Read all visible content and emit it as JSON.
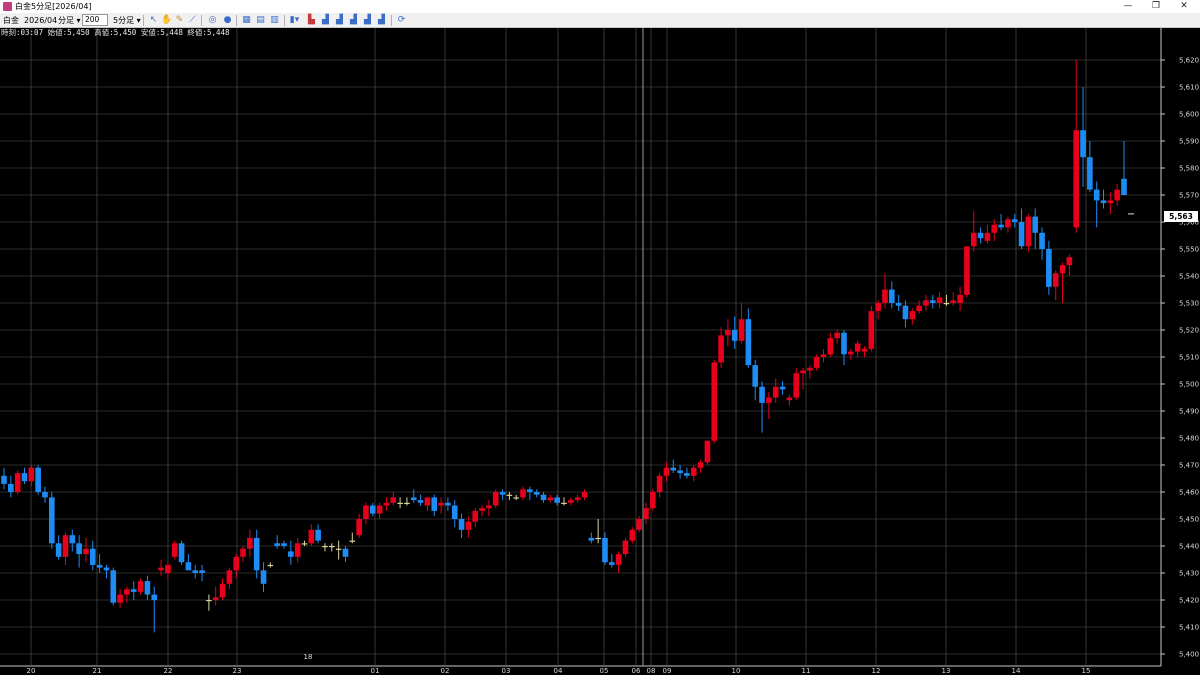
{
  "window": {
    "title": "白金5分足[2026/04]",
    "controls": [
      "—",
      "❐",
      "✕"
    ]
  },
  "toolbar": {
    "symbol": "白金",
    "contract": "2026/04",
    "unit_select": "分足 ▾",
    "count_value": "200",
    "interval_select": "5分足 ▾",
    "icons": [
      "cursor-icon",
      "hand-icon",
      "pencil-icon",
      "trend-line-icon",
      "circle-icon",
      "grid-icon",
      "table-icon",
      "list-icon",
      "bar-chart-icon",
      "bar-chart-red-icon",
      "bar-chart-2-icon",
      "bar-chart-3-icon",
      "bar-chart-4-icon",
      "bar-chart-5-icon",
      "refresh-icon"
    ]
  },
  "info": "時刻:03:07 始値:5,450 高値:5,450 安値:5,448 終値:5,448",
  "current_price": "5,563",
  "colors": {
    "up": "#e8001c",
    "down": "#1e8cf5",
    "doji": "#d8d49a",
    "grid": "#5a5a5a",
    "background": "#000000"
  },
  "chart_data": {
    "type": "candlestick",
    "y_axis": {
      "min": 5400,
      "max": 5620,
      "tick_step": 10,
      "tick_labels": [
        "5,400",
        "5,410",
        "5,420",
        "5,430",
        "5,440",
        "5,450",
        "5,460",
        "5,470",
        "5,480",
        "5,490",
        "5,500",
        "5,510",
        "5,520",
        "5,530",
        "5,540",
        "5,550",
        "5,560",
        "5,570",
        "5,580",
        "5,590",
        "5,600",
        "5,610",
        "5,620"
      ]
    },
    "x_labels": [
      "20",
      "21",
      "22",
      "23",
      "18",
      "01",
      "02",
      "03",
      "04",
      "05",
      "06",
      "08",
      "09",
      "10",
      "11",
      "12",
      "13",
      "14",
      "15"
    ],
    "ohlc": [
      [
        5466,
        5469,
        5461,
        5463
      ],
      [
        5463,
        5466,
        5458,
        5460
      ],
      [
        5460,
        5468,
        5459,
        5467
      ],
      [
        5467,
        5469,
        5463,
        5464
      ],
      [
        5464,
        5470,
        5462,
        5469
      ],
      [
        5469,
        5470,
        5459,
        5460
      ],
      [
        5460,
        5462,
        5456,
        5458
      ],
      [
        5458,
        5460,
        5439,
        5441
      ],
      [
        5441,
        5444,
        5435,
        5436
      ],
      [
        5436,
        5445,
        5433,
        5444
      ],
      [
        5444,
        5446,
        5438,
        5441
      ],
      [
        5441,
        5444,
        5432,
        5437
      ],
      [
        5437,
        5443,
        5434,
        5439
      ],
      [
        5439,
        5442,
        5431,
        5433
      ],
      [
        5433,
        5437,
        5430,
        5432
      ],
      [
        5432,
        5433,
        5428,
        5431
      ],
      [
        5431,
        5432,
        5418,
        5419
      ],
      [
        5419,
        5424,
        5417,
        5422
      ],
      [
        5422,
        5425,
        5419,
        5424
      ],
      [
        5424,
        5427,
        5420,
        5423
      ],
      [
        5423,
        5428,
        5422,
        5427
      ],
      [
        5427,
        5429,
        5420,
        5422
      ],
      [
        5422,
        5425,
        5408,
        5420
      ],
      [
        5431,
        5435,
        5429,
        5432
      ],
      [
        5430,
        5434,
        5428,
        5433
      ],
      [
        5436,
        5442,
        5435,
        5441
      ],
      [
        5441,
        5442,
        5433,
        5434
      ],
      [
        5434,
        5437,
        5431,
        5431
      ],
      [
        5431,
        5433,
        5428,
        5430
      ],
      [
        5431,
        5433,
        5427,
        5430
      ],
      [
        5420,
        5422,
        5416,
        5420
      ],
      [
        5420,
        5425,
        5418,
        5421
      ],
      [
        5421,
        5428,
        5420,
        5426
      ],
      [
        5426,
        5432,
        5424,
        5431
      ],
      [
        5431,
        5437,
        5428,
        5436
      ],
      [
        5436,
        5440,
        5434,
        5439
      ],
      [
        5439,
        5446,
        5436,
        5443
      ],
      [
        5443,
        5446,
        5428,
        5431
      ],
      [
        5431,
        5434,
        5423,
        5426
      ],
      [
        5433,
        5434,
        5432,
        5433
      ],
      [
        5441,
        5444,
        5439,
        5440
      ],
      [
        5441,
        5442,
        5439,
        5440
      ],
      [
        5438,
        5442,
        5433,
        5436
      ],
      [
        5436,
        5443,
        5434,
        5441
      ],
      [
        5441,
        5442,
        5440,
        5441
      ],
      [
        5441,
        5448,
        5440,
        5446
      ],
      [
        5446,
        5448,
        5441,
        5442
      ],
      [
        5440,
        5441,
        5438,
        5440
      ],
      [
        5440,
        5441,
        5438,
        5440
      ],
      [
        5439,
        5442,
        5435,
        5439
      ],
      [
        5439,
        5440,
        5434,
        5436
      ],
      [
        5442,
        5445,
        5441,
        5442
      ],
      [
        5444,
        5452,
        5443,
        5450
      ],
      [
        5450,
        5456,
        5448,
        5455
      ],
      [
        5455,
        5456,
        5451,
        5452
      ],
      [
        5452,
        5456,
        5450,
        5455
      ],
      [
        5455,
        5458,
        5453,
        5456
      ],
      [
        5456,
        5460,
        5455,
        5458
      ],
      [
        5456,
        5458,
        5454,
        5456
      ],
      [
        5456,
        5458,
        5455,
        5456
      ],
      [
        5458,
        5461,
        5456,
        5457
      ],
      [
        5457,
        5459,
        5455,
        5456
      ],
      [
        5455,
        5458,
        5453,
        5458
      ],
      [
        5458,
        5459,
        5451,
        5453
      ],
      [
        5455,
        5458,
        5452,
        5456
      ],
      [
        5456,
        5458,
        5453,
        5455
      ],
      [
        5455,
        5457,
        5447,
        5450
      ],
      [
        5450,
        5452,
        5443,
        5446
      ],
      [
        5446,
        5451,
        5443,
        5449
      ],
      [
        5449,
        5454,
        5447,
        5453
      ],
      [
        5453,
        5455,
        5451,
        5454
      ],
      [
        5454,
        5457,
        5451,
        5455
      ],
      [
        5455,
        5461,
        5454,
        5460
      ],
      [
        5460,
        5461,
        5457,
        5459
      ],
      [
        5459,
        5460,
        5457,
        5459
      ],
      [
        5458,
        5459,
        5457,
        5458
      ],
      [
        5458,
        5462,
        5457,
        5461
      ],
      [
        5461,
        5462,
        5457,
        5460
      ],
      [
        5460,
        5461,
        5458,
        5459
      ],
      [
        5459,
        5460,
        5456,
        5457
      ],
      [
        5457,
        5459,
        5456,
        5458
      ],
      [
        5458,
        5459,
        5455,
        5456
      ],
      [
        5456,
        5458,
        5455,
        5456
      ],
      [
        5456,
        5458,
        5455,
        5457
      ],
      [
        5457,
        5459,
        5456,
        5458
      ],
      [
        5458,
        5461,
        5457,
        5460
      ],
      [
        5443,
        5445,
        5441,
        5442
      ],
      [
        5443,
        5450,
        5441,
        5443
      ],
      [
        5443,
        5445,
        5433,
        5434
      ],
      [
        5434,
        5437,
        5432,
        5433
      ],
      [
        5433,
        5438,
        5430,
        5437
      ],
      [
        5437,
        5443,
        5436,
        5442
      ],
      [
        5442,
        5447,
        5441,
        5446
      ],
      [
        5446,
        5451,
        5445,
        5450
      ],
      [
        5450,
        5456,
        5448,
        5454
      ],
      [
        5454,
        5461,
        5453,
        5460
      ],
      [
        5460,
        5467,
        5458,
        5466
      ],
      [
        5466,
        5471,
        5464,
        5469
      ],
      [
        5469,
        5472,
        5467,
        5468
      ],
      [
        5468,
        5470,
        5465,
        5467
      ],
      [
        5467,
        5469,
        5465,
        5466
      ],
      [
        5466,
        5470,
        5464,
        5469
      ],
      [
        5469,
        5472,
        5467,
        5471
      ],
      [
        5471,
        5479,
        5470,
        5479
      ],
      [
        5479,
        5509,
        5478,
        5508
      ],
      [
        5508,
        5521,
        5506,
        5518
      ],
      [
        5518,
        5524,
        5514,
        5520
      ],
      [
        5520,
        5525,
        5513,
        5516
      ],
      [
        5516,
        5530,
        5515,
        5524
      ],
      [
        5524,
        5528,
        5506,
        5507
      ],
      [
        5507,
        5509,
        5494,
        5499
      ],
      [
        5499,
        5501,
        5482,
        5493
      ],
      [
        5493,
        5497,
        5487,
        5495
      ],
      [
        5495,
        5502,
        5493,
        5499
      ],
      [
        5499,
        5501,
        5496,
        5498
      ],
      [
        5494,
        5496,
        5492,
        5495
      ],
      [
        5495,
        5506,
        5494,
        5504
      ],
      [
        5504,
        5506,
        5498,
        5505
      ],
      [
        5505,
        5507,
        5502,
        5506
      ],
      [
        5506,
        5511,
        5505,
        5510
      ],
      [
        5510,
        5513,
        5508,
        5511
      ],
      [
        5511,
        5519,
        5510,
        5517
      ],
      [
        5517,
        5520,
        5515,
        5519
      ],
      [
        5519,
        5520,
        5507,
        5511
      ],
      [
        5511,
        5513,
        5509,
        5512
      ],
      [
        5512,
        5516,
        5510,
        5515
      ],
      [
        5512,
        5514,
        5510,
        5513
      ],
      [
        5513,
        5529,
        5512,
        5527
      ],
      [
        5527,
        5531,
        5524,
        5530
      ],
      [
        5530,
        5541,
        5528,
        5535
      ],
      [
        5535,
        5538,
        5528,
        5530
      ],
      [
        5530,
        5533,
        5527,
        5529
      ],
      [
        5529,
        5531,
        5521,
        5524
      ],
      [
        5524,
        5528,
        5522,
        5527
      ],
      [
        5527,
        5531,
        5526,
        5529
      ],
      [
        5529,
        5533,
        5527,
        5531
      ],
      [
        5531,
        5533,
        5528,
        5530
      ],
      [
        5530,
        5534,
        5528,
        5532
      ],
      [
        5530,
        5533,
        5529,
        5530
      ],
      [
        5530,
        5534,
        5529,
        5531
      ],
      [
        5530,
        5536,
        5527,
        5533
      ],
      [
        5533,
        5546,
        5532,
        5551
      ],
      [
        5551,
        5564,
        5549,
        5556
      ],
      [
        5556,
        5558,
        5552,
        5554
      ],
      [
        5553,
        5559,
        5552,
        5556
      ],
      [
        5556,
        5561,
        5553,
        5559
      ],
      [
        5559,
        5563,
        5557,
        5558
      ],
      [
        5558,
        5562,
        5556,
        5561
      ],
      [
        5561,
        5563,
        5558,
        5560
      ],
      [
        5560,
        5565,
        5550,
        5551
      ],
      [
        5551,
        5563,
        5549,
        5562
      ],
      [
        5562,
        5565,
        5550,
        5556
      ],
      [
        5556,
        5558,
        5546,
        5550
      ],
      [
        5550,
        5553,
        5533,
        5536
      ],
      [
        5536,
        5542,
        5531,
        5541
      ],
      [
        5541,
        5545,
        5530,
        5544
      ],
      [
        5544,
        5548,
        5540,
        5547
      ],
      [
        5558,
        5620,
        5556,
        5594
      ],
      [
        5594,
        5610,
        5573,
        5584
      ],
      [
        5584,
        5590,
        5571,
        5572
      ],
      [
        5572,
        5575,
        5558,
        5568
      ],
      [
        5568,
        5572,
        5565,
        5567
      ],
      [
        5567,
        5571,
        5563,
        5568
      ],
      [
        5568,
        5574,
        5566,
        5572
      ],
      [
        5576,
        5590,
        5574,
        5570
      ]
    ]
  }
}
